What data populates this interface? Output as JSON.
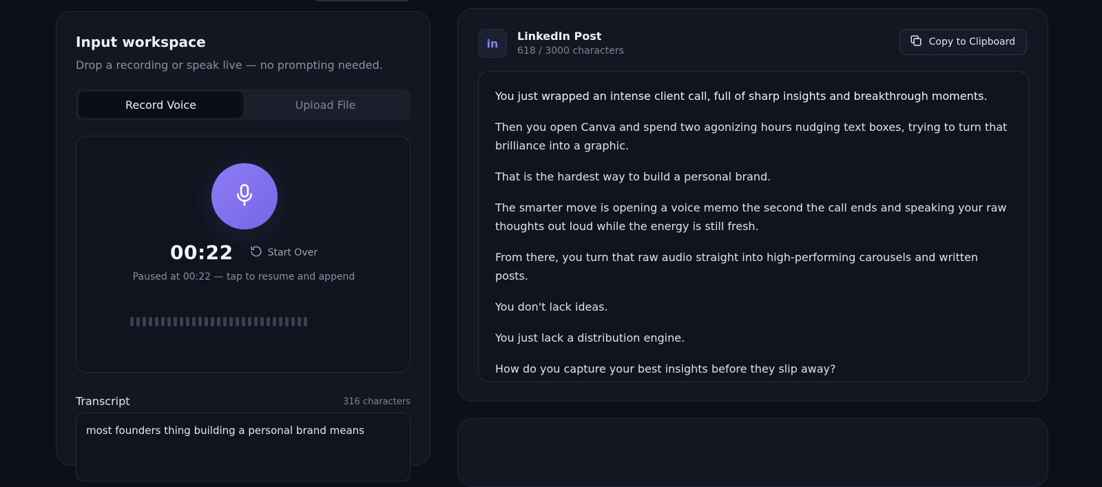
{
  "workspace": {
    "title": "Input workspace",
    "subtitle": "Drop a recording or speak live — no prompting needed.",
    "tabs": [
      {
        "label": "Record Voice",
        "active": true
      },
      {
        "label": "Upload File",
        "active": false
      }
    ]
  },
  "recorder": {
    "timer": "00:22",
    "start_over_label": "Start Over",
    "paused_text": "Paused at 00:22 — tap to resume and append",
    "mic_icon": "microphone-icon",
    "start_over_icon": "rotate-ccw-icon",
    "accent_color": "#7f6ff0"
  },
  "transcript": {
    "label": "Transcript",
    "count": "316 characters",
    "text": "most founders thing building a personal brand means"
  },
  "post": {
    "platform_icon": "linkedin-icon",
    "badge_text": "in",
    "title": "LinkedIn Post",
    "char_count": "618 / 3000 characters",
    "copy_label": "Copy to Clipboard",
    "copy_icon": "copy-icon",
    "paragraphs": [
      "You just wrapped an intense client call, full of sharp insights and breakthrough moments.",
      "Then you open Canva and spend two agonizing hours nudging text boxes, trying to turn that brilliance into a graphic.",
      "That is the hardest way to build a personal brand.",
      "The smarter move is opening a voice memo the second the call ends and speaking your raw thoughts out loud while the energy is still fresh.",
      "From there, you turn that raw audio straight into high-performing carousels and written posts.",
      "You don't lack ideas.",
      "You just lack a distribution engine.",
      "How do you capture your best insights before they slip away?"
    ]
  }
}
